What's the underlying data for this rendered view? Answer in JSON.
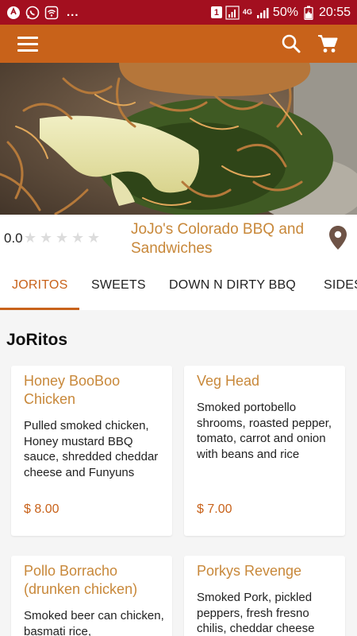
{
  "status_bar": {
    "notification_dots": "...",
    "sim_slot": "1",
    "network": "4G",
    "battery": "50%",
    "time": "20:55"
  },
  "app_bar": {
    "menu_icon": "hamburger-menu-icon",
    "search_icon": "search-icon",
    "cart_icon": "shopping-cart-icon"
  },
  "restaurant": {
    "name": "JoJo's Colorado BBQ and Sandwiches",
    "rating": "0.0",
    "stars": 5,
    "location_icon": "map-pin-icon"
  },
  "tabs": [
    {
      "label": "JORITOS",
      "active": true
    },
    {
      "label": "SWEETS",
      "active": false
    },
    {
      "label": "DOWN N DIRTY BBQ",
      "active": false
    },
    {
      "label": "SIDES",
      "active": false
    }
  ],
  "section": {
    "title": "JoRitos",
    "items": [
      {
        "name": "Honey BooBoo Chicken",
        "description": "Pulled smoked chicken, Honey mustard BBQ sauce, shredded cheddar cheese and Funyuns",
        "price": "$ 8.00"
      },
      {
        "name": "Veg Head",
        "description": "Smoked portobello shrooms, roasted pepper, tomato, carrot and onion with beans and rice",
        "price": "$ 7.00"
      },
      {
        "name": "Pollo Borracho (drunken chicken)",
        "description": "Smoked beer can chicken, basmati rice,",
        "price": ""
      },
      {
        "name": "Porkys Revenge",
        "description": "Smoked Pork, pickled peppers, fresh fresno chilis, cheddar cheese",
        "price": ""
      }
    ]
  },
  "colors": {
    "status_bar": "#a30f1f",
    "app_bar": "#c8621a",
    "accent_text": "#c8883a",
    "price": "#c8621a"
  }
}
